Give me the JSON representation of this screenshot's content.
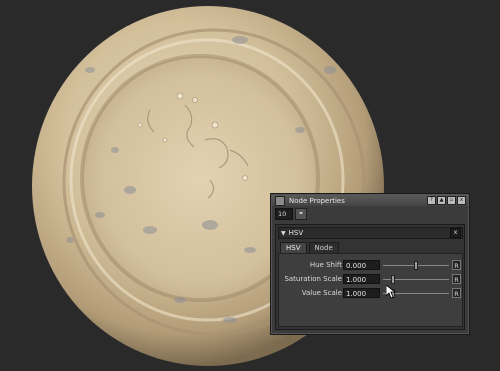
{
  "window": {
    "title": "Node Properties",
    "controls": [
      "?",
      "▲",
      "▫",
      "x"
    ]
  },
  "toolbar": {
    "field_value": "10",
    "button_glyph": "⚭"
  },
  "section": {
    "title": "HSV",
    "collapse_glyph": "▼",
    "close_label": "x"
  },
  "tabs": [
    {
      "label": "HSV",
      "active": true
    },
    {
      "label": "Node",
      "active": false
    }
  ],
  "params": [
    {
      "label": "Hue Shift",
      "value": "0.000",
      "slider_fraction": 0.5,
      "reset_label": "R"
    },
    {
      "label": "Saturation Scale",
      "value": "1.000",
      "slider_fraction": 0.15,
      "reset_label": "R"
    },
    {
      "label": "Value Scale",
      "value": "1.000",
      "slider_fraction": 0.15,
      "reset_label": "R"
    }
  ],
  "colors": {
    "background": "#2a2a2a",
    "material_base": "#d8c6a3",
    "panel": "#3b3b3b"
  },
  "icons": {
    "title_icon": "node-icon",
    "cursor": "mouse-pointer-icon"
  }
}
